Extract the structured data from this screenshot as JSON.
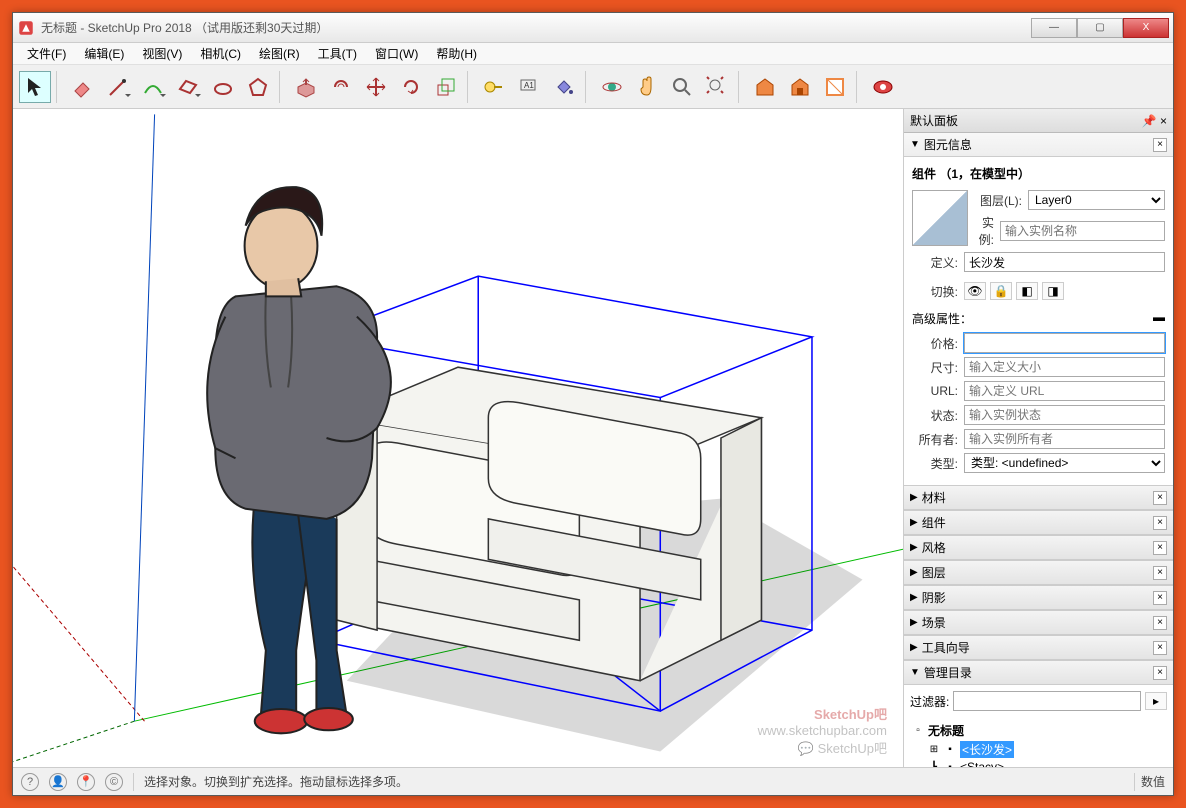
{
  "window": {
    "title": "无标题 - SketchUp Pro 2018  （试用版还剩30天过期）",
    "min": "—",
    "max": "▢",
    "close": "X"
  },
  "menus": [
    "文件(F)",
    "编辑(E)",
    "视图(V)",
    "相机(C)",
    "绘图(R)",
    "工具(T)",
    "窗口(W)",
    "帮助(H)"
  ],
  "sidepanel": {
    "default_tray": "默认面板",
    "entity_info": "图元信息",
    "component_header": "组件 （1，在模型中）",
    "layer_label": "图层(L):",
    "layer_value": "Layer0",
    "instance_label": "实例:",
    "instance_ph": "输入实例名称",
    "definition_label": "定义:",
    "definition_value": "长沙发",
    "toggle_label": "切换:",
    "advanced": "高级属性：",
    "price_label": "价格:",
    "price_value": "",
    "size_label": "尺寸:",
    "size_ph": "输入定义大小",
    "url_label": "URL:",
    "url_ph": "输入定义 URL",
    "status_label": "状态:",
    "status_ph": "输入实例状态",
    "owner_label": "所有者:",
    "owner_ph": "输入实例所有者",
    "type_label": "类型:",
    "type_value": "类型: <undefined>",
    "sections": [
      "材料",
      "组件",
      "风格",
      "图层",
      "阴影",
      "场景",
      "工具向导",
      "管理目录"
    ],
    "filter_label": "过滤器:",
    "tree_root": "无标题",
    "tree_item1": "<长沙发>",
    "tree_item2": "<Stacy>"
  },
  "status": {
    "hint": "选择对象。切换到扩充选择。拖动鼠标选择多项。",
    "value_label": "数值"
  },
  "watermark": {
    "line1": "SketchUp吧",
    "line2": "www.sketchupbar.com",
    "line3": "SketchUp吧"
  }
}
